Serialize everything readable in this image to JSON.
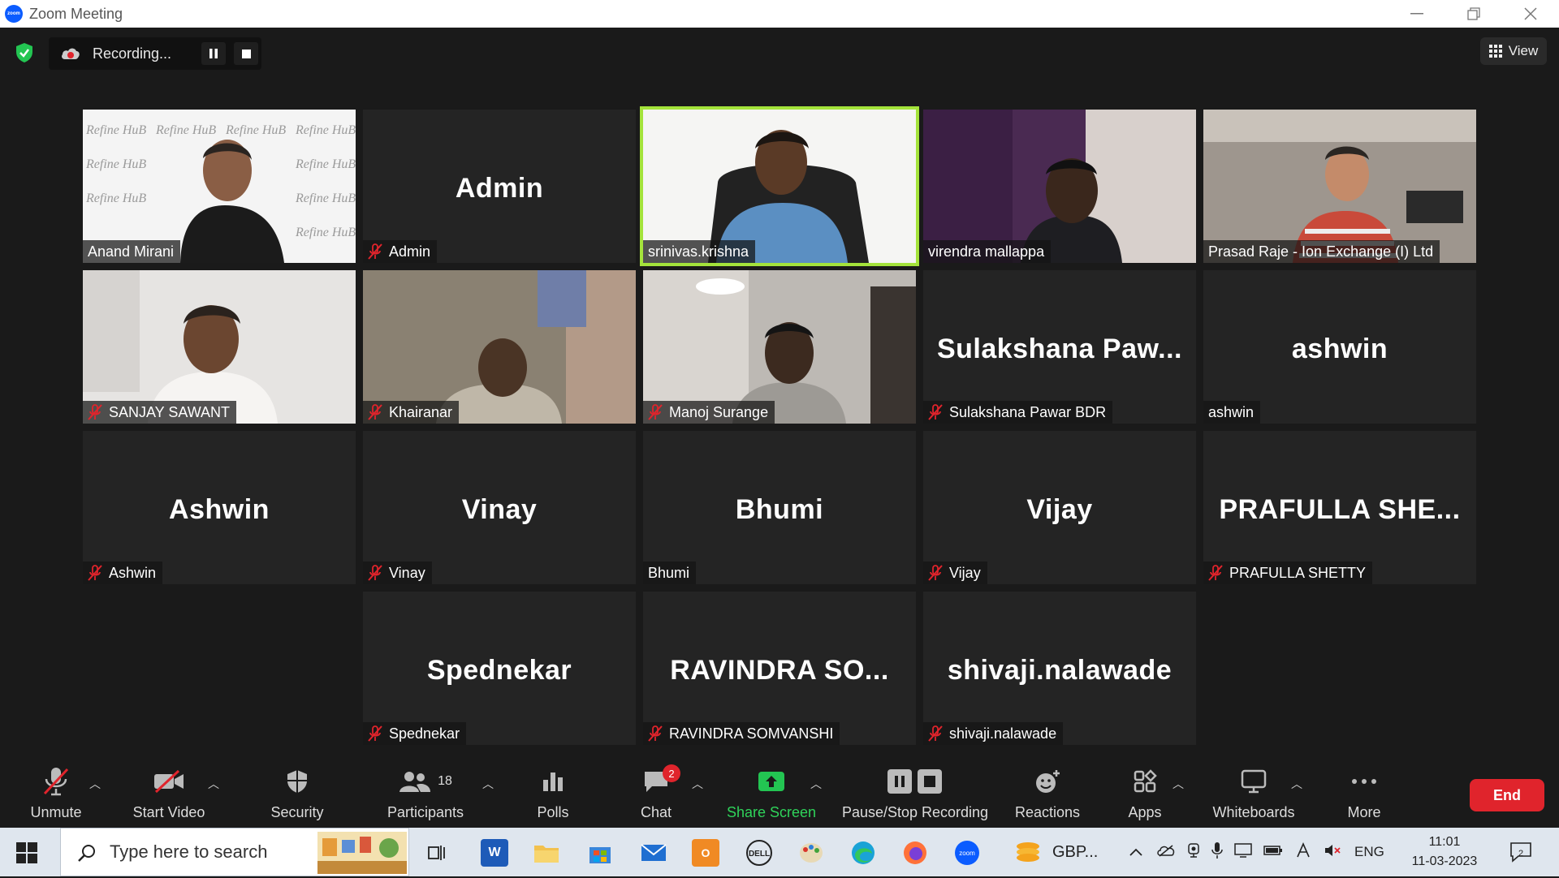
{
  "window": {
    "title": "Zoom Meeting",
    "minimize_icon": "minimize-icon",
    "restore_icon": "restore-icon",
    "close_icon": "close-icon"
  },
  "topbar": {
    "recording_label": "Recording...",
    "view_label": "View"
  },
  "tiles": [
    {
      "display_name": "Anand Mirani",
      "big_name": "",
      "muted": false,
      "video": true
    },
    {
      "display_name": "Admin",
      "big_name": "Admin",
      "muted": true,
      "video": false
    },
    {
      "display_name": "srinivas.krishna",
      "big_name": "",
      "muted": false,
      "video": true,
      "active_speaker": true
    },
    {
      "display_name": "virendra mallappa",
      "big_name": "",
      "muted": false,
      "video": true
    },
    {
      "display_name": "Prasad Raje - Ion Exchange (I) Ltd",
      "big_name": "",
      "muted": false,
      "video": true
    },
    {
      "display_name": "SANJAY SAWANT",
      "big_name": "",
      "muted": true,
      "video": true
    },
    {
      "display_name": "Khairanar",
      "big_name": "",
      "muted": true,
      "video": true
    },
    {
      "display_name": "Manoj Surange",
      "big_name": "",
      "muted": true,
      "video": true
    },
    {
      "display_name": "Sulakshana Pawar BDR",
      "big_name": "Sulakshana  Paw...",
      "muted": true,
      "video": false
    },
    {
      "display_name": "ashwin",
      "big_name": "ashwin",
      "muted": false,
      "video": false
    },
    {
      "display_name": "Ashwin",
      "big_name": "Ashwin",
      "muted": true,
      "video": false
    },
    {
      "display_name": "Vinay",
      "big_name": "Vinay",
      "muted": true,
      "video": false
    },
    {
      "display_name": "Bhumi",
      "big_name": "Bhumi",
      "muted": false,
      "video": false
    },
    {
      "display_name": "Vijay",
      "big_name": "Vijay",
      "muted": true,
      "video": false
    },
    {
      "display_name": "PRAFULLA SHETTY",
      "big_name": "PRAFULLA  SHE...",
      "muted": true,
      "video": false
    },
    {
      "display_name": "Spednekar",
      "big_name": "Spednekar",
      "muted": true,
      "video": false
    },
    {
      "display_name": "RAVINDRA SOMVANSHI",
      "big_name": "RAVINDRA  SO...",
      "muted": true,
      "video": false
    },
    {
      "display_name": "shivaji.nalawade",
      "big_name": "shivaji.nalawade",
      "muted": true,
      "video": false
    }
  ],
  "background_logo_text": "Refine HuB",
  "toolbar": {
    "unmute": "Unmute",
    "start_video": "Start Video",
    "security": "Security",
    "participants": "Participants",
    "participants_count": "18",
    "polls": "Polls",
    "chat": "Chat",
    "chat_badge": "2",
    "share_screen": "Share Screen",
    "pause_stop_recording": "Pause/Stop Recording",
    "reactions": "Reactions",
    "apps": "Apps",
    "whiteboards": "Whiteboards",
    "more": "More",
    "end": "End",
    "accent_green": "#2fd35a",
    "end_red": "#e0242c"
  },
  "taskbar": {
    "search_placeholder": "Type here to search",
    "pinned_app_label": "GBP...",
    "language": "ENG",
    "time": "11:01",
    "date": "11-03-2023",
    "notification_count": "2"
  }
}
